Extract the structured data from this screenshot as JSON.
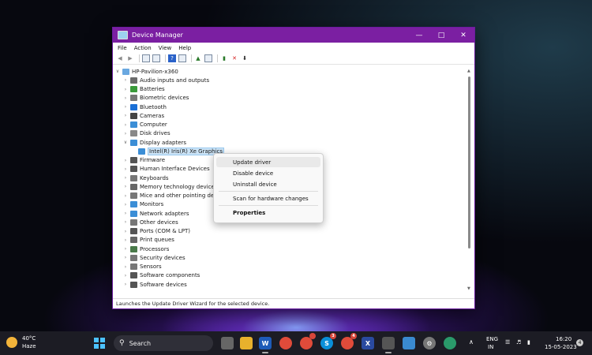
{
  "window": {
    "title": "Device Manager"
  },
  "menu": [
    "File",
    "Action",
    "View",
    "Help"
  ],
  "tree": {
    "root": "HP-Pavilion-x360",
    "categories": [
      {
        "label": "Audio inputs and outputs",
        "icon": "speaker-icon",
        "color": "#6b6b6b"
      },
      {
        "label": "Batteries",
        "icon": "battery-icon",
        "color": "#3a9a3a"
      },
      {
        "label": "Biometric devices",
        "icon": "fingerprint-icon",
        "color": "#777777"
      },
      {
        "label": "Bluetooth",
        "icon": "bluetooth-icon",
        "color": "#1a6fd6"
      },
      {
        "label": "Cameras",
        "icon": "camera-icon",
        "color": "#444444"
      },
      {
        "label": "Computer",
        "icon": "computer-icon",
        "color": "#3b8ed6"
      },
      {
        "label": "Disk drives",
        "icon": "disk-icon",
        "color": "#888888"
      },
      {
        "label": "Display adapters",
        "icon": "display-adapter-icon",
        "color": "#3b8ed6",
        "expanded": true,
        "children": [
          "Intel(R) Iris(R) Xe Graphics"
        ]
      },
      {
        "label": "Firmware",
        "icon": "firmware-icon",
        "color": "#555555"
      },
      {
        "label": "Human Interface Devices",
        "icon": "hid-icon",
        "color": "#555555"
      },
      {
        "label": "Keyboards",
        "icon": "keyboard-icon",
        "color": "#777777"
      },
      {
        "label": "Memory technology devices",
        "icon": "memory-icon",
        "color": "#666666"
      },
      {
        "label": "Mice and other pointing dev",
        "icon": "mouse-icon",
        "color": "#777777"
      },
      {
        "label": "Monitors",
        "icon": "monitor-icon",
        "color": "#3b8ed6"
      },
      {
        "label": "Network adapters",
        "icon": "network-icon",
        "color": "#3b8ed6"
      },
      {
        "label": "Other devices",
        "icon": "other-device-icon",
        "color": "#777777"
      },
      {
        "label": "Ports (COM & LPT)",
        "icon": "port-icon",
        "color": "#555555"
      },
      {
        "label": "Print queues",
        "icon": "printer-icon",
        "color": "#666666"
      },
      {
        "label": "Processors",
        "icon": "processor-icon",
        "color": "#4a7a4a"
      },
      {
        "label": "Security devices",
        "icon": "security-icon",
        "color": "#777777"
      },
      {
        "label": "Sensors",
        "icon": "sensor-icon",
        "color": "#777777"
      },
      {
        "label": "Software components",
        "icon": "software-component-icon",
        "color": "#555555"
      },
      {
        "label": "Software devices",
        "icon": "software-device-icon",
        "color": "#555555"
      }
    ]
  },
  "context_menu": {
    "items": [
      "Update driver",
      "Disable device",
      "Uninstall device"
    ],
    "scan": "Scan for hardware changes",
    "properties": "Properties"
  },
  "status_bar": "Launches the Update Driver Wizard for the selected device.",
  "taskbar": {
    "weather_temp": "40°C",
    "weather_desc": "Haze",
    "search_label": "Search",
    "badges": {
      "chrome_profile": "",
      "skype": "3",
      "chrome_alt": "4"
    },
    "language": "ENG",
    "region": "IN",
    "time": "16:20",
    "date": "15-05-2023",
    "notification_count": "4"
  },
  "colors": {
    "titlebar": "#7b1fa2",
    "selection": "#cce4f7",
    "taskbar": "#1c1c24"
  }
}
